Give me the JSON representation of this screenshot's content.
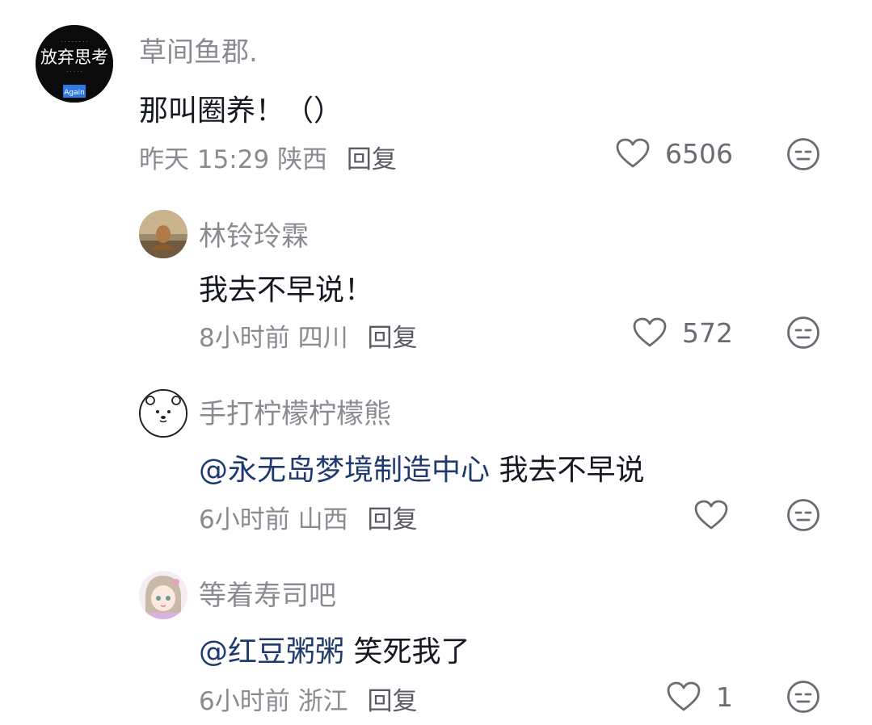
{
  "comments": [
    {
      "avatar_icon": "book-cover-avatar-icon",
      "avatar_text": "放弃思考",
      "avatar_small_text": "Again",
      "username": "草间鱼郡.",
      "content": "那叫圈养！（）",
      "mention": "",
      "time": "昨天 15:29",
      "location": "陕西",
      "reply_label": "回复",
      "like_count": "6506"
    },
    {
      "avatar_icon": "statue-avatar-icon",
      "username": "林铃玲霖",
      "content": "我去不早说！",
      "mention": "",
      "time": "8小时前",
      "location": "四川",
      "reply_label": "回复",
      "like_count": "572"
    },
    {
      "avatar_icon": "white-bear-avatar-icon",
      "username": "手打柠檬柠檬熊",
      "mention": "@永无岛梦境制造中心",
      "content": " 我去不早说",
      "time": "6小时前",
      "location": "山西",
      "reply_label": "回复",
      "like_count": ""
    },
    {
      "avatar_icon": "anime-girl-avatar-icon",
      "username": "等着寿司吧",
      "mention": "@红豆粥粥",
      "content": " 笑死我了",
      "time": "6小时前",
      "location": "浙江",
      "reply_label": "回复",
      "like_count": "1"
    }
  ],
  "icons": {
    "like": "heart-outline-icon",
    "dislike": "dislike-face-icon"
  },
  "colors": {
    "username": "#8a8b91",
    "mention": "#1e3a6e",
    "text": "#161823"
  }
}
